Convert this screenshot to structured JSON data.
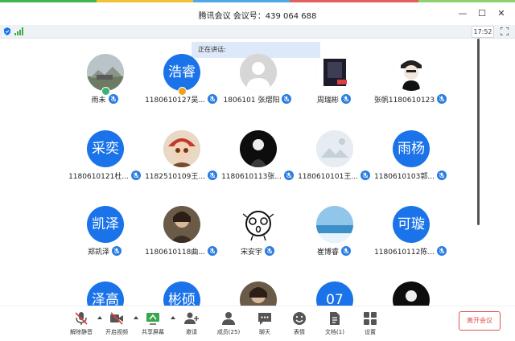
{
  "window": {
    "title": "腾讯会议 会议号：439 064 688",
    "controls": [
      "minimize",
      "maximize",
      "close"
    ]
  },
  "status": {
    "time": "17:52"
  },
  "speaking_label": "正在讲话:",
  "colors": {
    "avatar_blue": "#1a73e8",
    "leave_red": "#e05050",
    "mic_blue": "#2a7de1"
  },
  "participants": [
    {
      "name": "雨未",
      "avatar": "photo-landscape",
      "initials": ""
    },
    {
      "name": "1180610127吴...",
      "avatar": "initials",
      "initials": "浩睿"
    },
    {
      "name": "1806101 张熠阳",
      "avatar": "default-person-icon",
      "initials": ""
    },
    {
      "name": "周瑞彬",
      "avatar": "photo-art",
      "initials": ""
    },
    {
      "name": "张帆1180610123",
      "avatar": "photo-cartoon",
      "initials": ""
    },
    {
      "name": "1180610121杜...",
      "avatar": "initials",
      "initials": "采奕"
    },
    {
      "name": "1182510109王...",
      "avatar": "photo-anime",
      "initials": ""
    },
    {
      "name": "1180610113张...",
      "avatar": "photo-dark",
      "initials": ""
    },
    {
      "name": "1180610101王...",
      "avatar": "image-placeholder",
      "initials": ""
    },
    {
      "name": "1180610103郭...",
      "avatar": "initials",
      "initials": "雨杨"
    },
    {
      "name": "郑凯泽",
      "avatar": "initials",
      "initials": "凯泽"
    },
    {
      "name": "1180610118曲...",
      "avatar": "photo-portrait",
      "initials": ""
    },
    {
      "name": "宋安宇",
      "avatar": "doodle-face",
      "initials": ""
    },
    {
      "name": "崔博睿",
      "avatar": "photo-sea",
      "initials": ""
    },
    {
      "name": "1180610112陈...",
      "avatar": "initials",
      "initials": "可璇"
    }
  ],
  "partial_row": [
    {
      "avatar": "initials",
      "initials": "泽高"
    },
    {
      "avatar": "initials",
      "initials": "彬硕"
    },
    {
      "avatar": "photo-portrait",
      "initials": ""
    },
    {
      "avatar": "initials",
      "initials": "07"
    },
    {
      "avatar": "photo-dark",
      "initials": ""
    }
  ],
  "toolbar": {
    "unmute": "解除静音",
    "start_video": "开启视频",
    "share_screen": "共享屏幕",
    "invite": "邀请",
    "members": "成员(25)",
    "chat": "聊天",
    "reactions": "表情",
    "documents": "文档(1)",
    "settings": "设置",
    "leave": "离开会议"
  }
}
